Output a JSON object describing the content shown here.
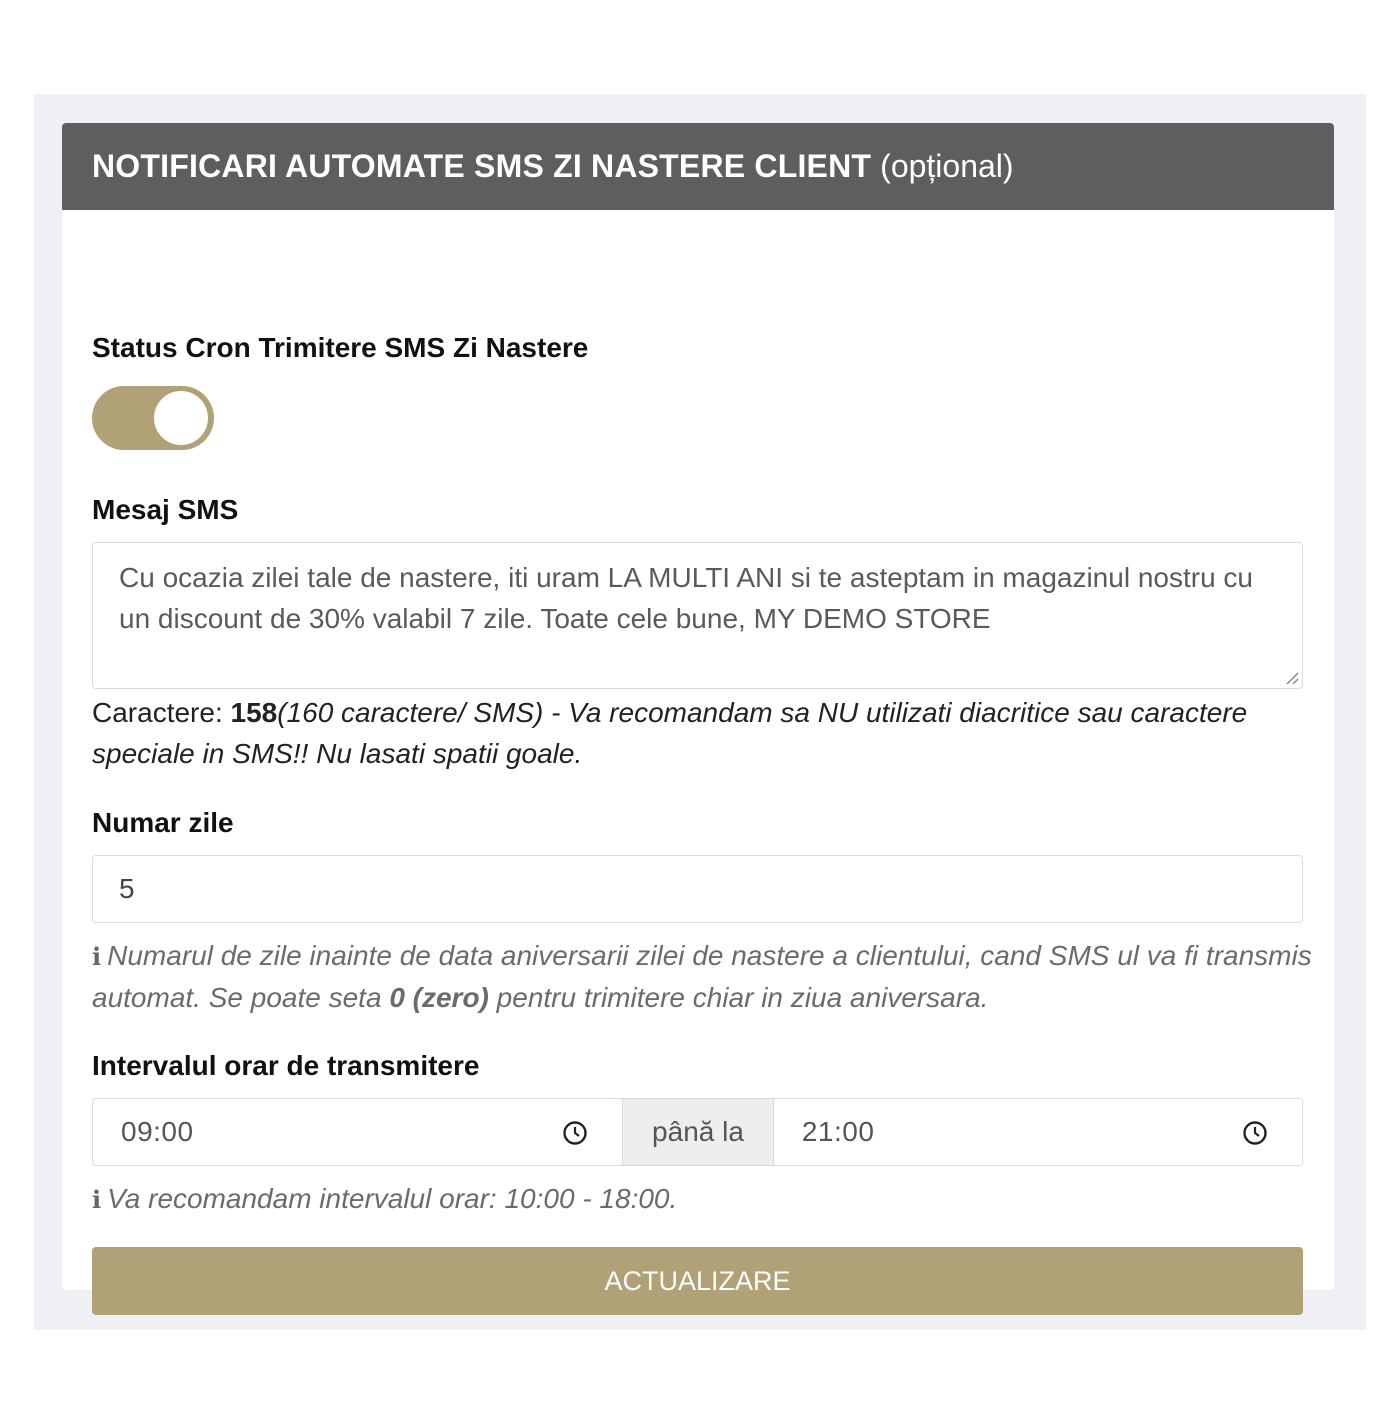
{
  "header": {
    "title": "NOTIFICARI AUTOMATE SMS ZI NASTERE CLIENT",
    "optional": "(opțional)"
  },
  "status": {
    "label": "Status Cron Trimitere SMS Zi Nastere",
    "toggle_on": true
  },
  "message": {
    "label": "Mesaj SMS",
    "value": "Cu ocazia zilei tale de nastere, iti uram LA MULTI ANI si te asteptam in magazinul nostru cu un discount de 30% valabil 7 zile. Toate cele bune, MY DEMO STORE",
    "chars_prefix": "Caractere: ",
    "chars_count": "158",
    "chars_note": "(160 caractere/ SMS) - Va recomandam sa NU utilizati diacritice sau caractere speciale in SMS!! Nu lasati spatii goale."
  },
  "days": {
    "label": "Numar zile",
    "value": "5",
    "hint_part1": "Numarul de zile inainte de data aniversarii zilei de nastere a clientului, cand SMS ul va fi transmis automat. Se poate seta ",
    "hint_bold": "0 (zero)",
    "hint_part2": " pentru trimitere chiar in ziua aniversara."
  },
  "interval": {
    "label": "Intervalul orar de transmitere",
    "from": "09:00",
    "separator": "până la",
    "to": "21:00",
    "hint": "Va recomandam intervalul orar: 10:00 - 18:00."
  },
  "submit_label": "ACTUALIZARE",
  "icons": {
    "info": "info-icon",
    "clock": "clock-icon"
  },
  "colors": {
    "header_bg": "#5e5e5e",
    "accent": "#b0a276",
    "page_bg": "#eef0f5"
  }
}
